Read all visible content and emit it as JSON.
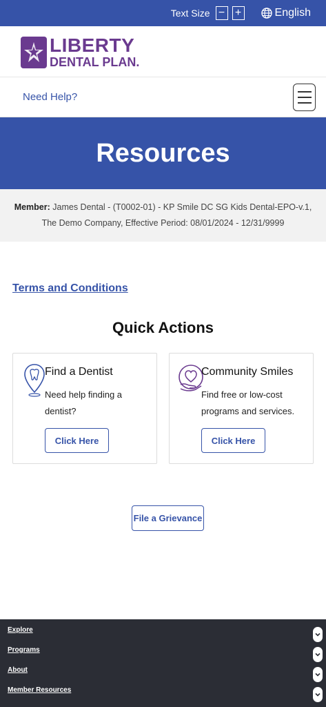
{
  "topbar": {
    "text_size_label": "Text Size",
    "decrease_label": "−",
    "increase_label": "+",
    "language": "English"
  },
  "brand": {
    "line1": "LIBERTY",
    "line2": "DENTAL PLAN."
  },
  "help": {
    "link": "Need Help?"
  },
  "hero": {
    "title": "Resources"
  },
  "member": {
    "label": "Member:",
    "line1": " James Dental - (T0002-01) - KP Smile DC SG Kids Dental-EPO-v.1,",
    "line2": "The Demo Company, Effective Period: 08/01/2024 - 12/31/9999"
  },
  "terms_link": "Terms and Conditions",
  "quick_actions": {
    "title": "Quick Actions",
    "cards": [
      {
        "title": "Find a Dentist",
        "description": "Need help finding a dentist?",
        "button": "Click Here",
        "icon": "tooth-location-icon"
      },
      {
        "title": "Community Smiles",
        "description": "Find free or low-cost programs and services.",
        "button": "Click Here",
        "icon": "heart-hand-icon"
      }
    ]
  },
  "grievance_button": "File a Grievance",
  "footer": {
    "items": [
      "Explore",
      "Programs",
      "About",
      "Member Resources"
    ]
  },
  "colors": {
    "brand_blue": "#3653a8",
    "brand_purple": "#6a3a8f",
    "footer_bg": "#2b2d35",
    "member_bg": "#f2f2f2"
  }
}
